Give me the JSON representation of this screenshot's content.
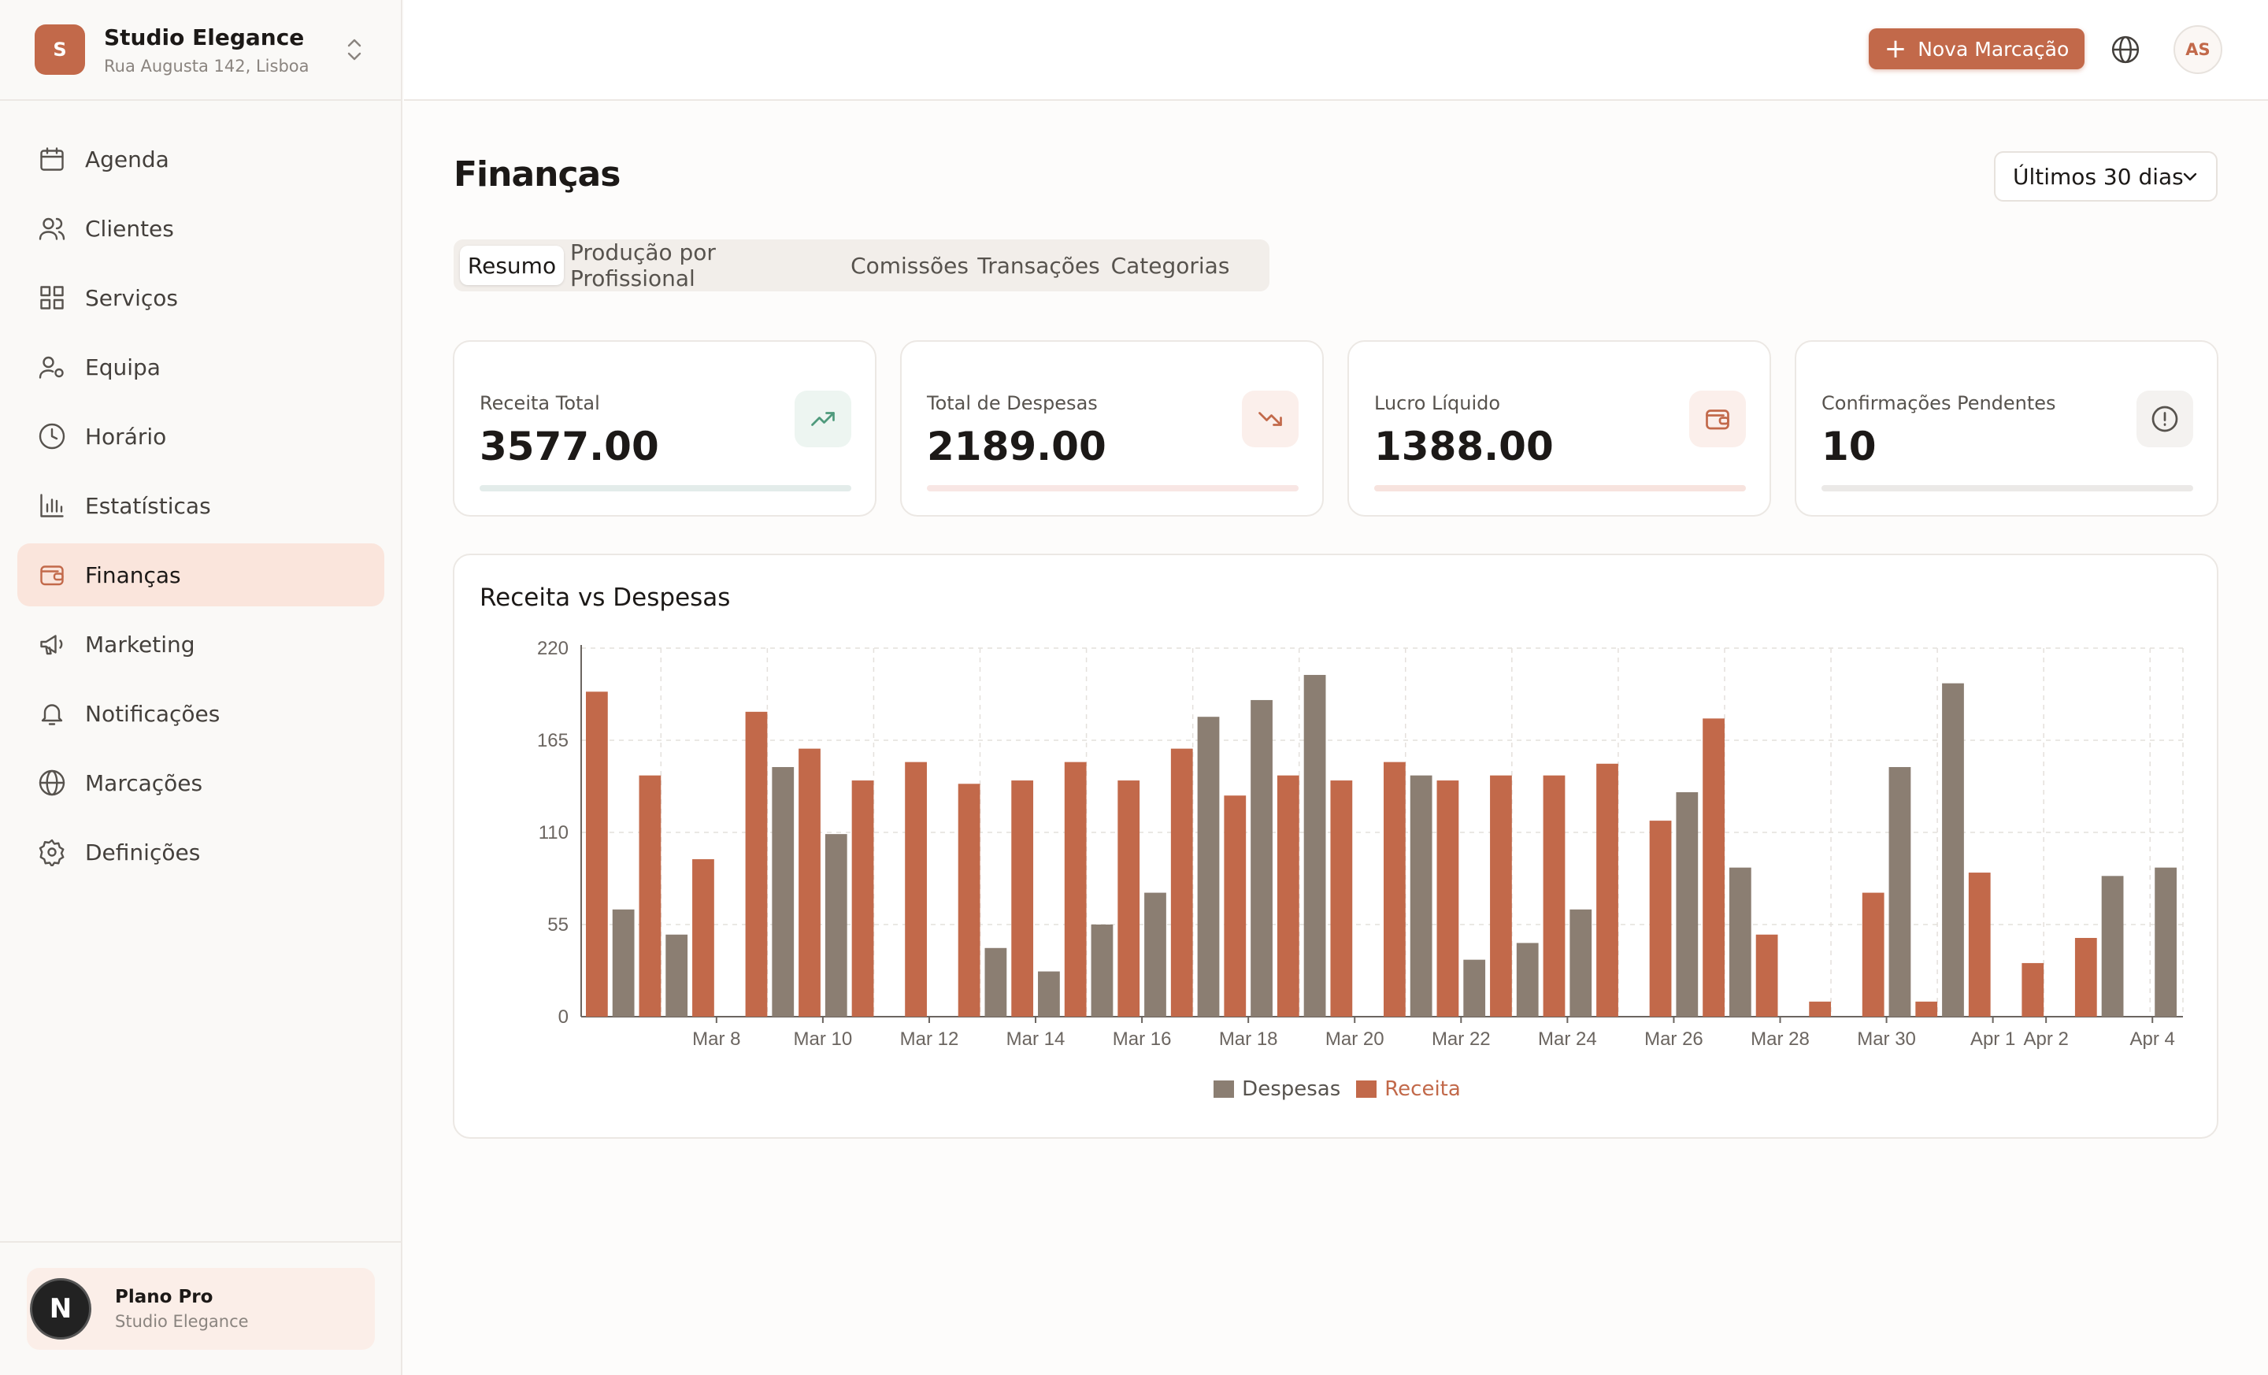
{
  "brand": {
    "initial": "S",
    "name": "Studio Elegance",
    "address": "Rua Augusta 142, Lisboa"
  },
  "nav": {
    "items": [
      {
        "label": "Agenda",
        "icon": "calendar-icon",
        "active": false
      },
      {
        "label": "Clientes",
        "icon": "users-icon",
        "active": false
      },
      {
        "label": "Serviços",
        "icon": "grid-icon",
        "active": false
      },
      {
        "label": "Equipa",
        "icon": "user-cog-icon",
        "active": false
      },
      {
        "label": "Horário",
        "icon": "clock-icon",
        "active": false
      },
      {
        "label": "Estatísticas",
        "icon": "bar-chart-icon",
        "active": false
      },
      {
        "label": "Finanças",
        "icon": "wallet-icon",
        "active": true
      },
      {
        "label": "Marketing",
        "icon": "megaphone-icon",
        "active": false
      },
      {
        "label": "Notificações",
        "icon": "bell-icon",
        "active": false
      },
      {
        "label": "Marcações",
        "icon": "globe-icon",
        "active": false
      },
      {
        "label": "Definições",
        "icon": "settings-icon",
        "active": false
      }
    ]
  },
  "plan": {
    "avatar": "N",
    "title": "Plano Pro",
    "subtitle": "Studio Elegance"
  },
  "topbar": {
    "new_booking": "Nova Marcação",
    "user_initials": "AS"
  },
  "page": {
    "title": "Finanças",
    "range": "Últimos 30 dias"
  },
  "tabs": [
    {
      "label": "Resumo",
      "active": true
    },
    {
      "label": "Produção por Profissional",
      "active": false
    },
    {
      "label": "Comissões",
      "active": false
    },
    {
      "label": "Transações",
      "active": false
    },
    {
      "label": "Categorias",
      "active": false
    }
  ],
  "cards": [
    {
      "label": "Receita Total",
      "value": "3577.00",
      "icon": "trending-up-icon",
      "icon_color": "#4f9a7c",
      "icon_bg": "#edf5f1",
      "bar_color": "#e3ecea"
    },
    {
      "label": "Total de Despesas",
      "value": "2189.00",
      "icon": "trending-down-icon",
      "icon_color": "#c2694a",
      "icon_bg": "#fbefeb",
      "bar_color": "#f8e6e4"
    },
    {
      "label": "Lucro Líquido",
      "value": "1388.00",
      "icon": "wallet-icon",
      "icon_color": "#c2694a",
      "icon_bg": "#fbefeb",
      "bar_color": "#f7e3de"
    },
    {
      "label": "Confirmações Pendentes",
      "value": "10",
      "icon": "alert-circle-icon",
      "icon_color": "#57534e",
      "icon_bg": "#f4f2f0",
      "bar_color": "#ebe9e7"
    }
  ],
  "chart": {
    "title": "Receita vs Despesas"
  },
  "chart_data": {
    "type": "bar",
    "ylim": [
      0,
      220
    ],
    "yticks": [
      0,
      55,
      110,
      165,
      220
    ],
    "categories": [
      "Mar 6",
      "Mar 7",
      "Mar 8",
      "Mar 9",
      "Mar 10",
      "Mar 11",
      "Mar 12",
      "Mar 13",
      "Mar 14",
      "Mar 15",
      "Mar 16",
      "Mar 17",
      "Mar 18",
      "Mar 19",
      "Mar 20",
      "Mar 21",
      "Mar 22",
      "Mar 23",
      "Mar 24",
      "Mar 25",
      "Mar 26",
      "Mar 27",
      "Mar 28",
      "Mar 29",
      "Mar 30",
      "Mar 31",
      "Apr 1",
      "Apr 2",
      "Apr 3",
      "Apr 4"
    ],
    "xtick_labels": [
      "Mar 8",
      "Mar 10",
      "Mar 12",
      "Mar 14",
      "Mar 16",
      "Mar 18",
      "Mar 20",
      "Mar 22",
      "Mar 24",
      "Mar 26",
      "Mar 28",
      "Mar 30",
      "Apr 1",
      "Apr 2",
      "Apr 4"
    ],
    "grid": true,
    "legend": "bottom-center",
    "series": [
      {
        "name": "Receita",
        "color": "#c2694a",
        "values": [
          194,
          144,
          94,
          182,
          160,
          141,
          152,
          139,
          141,
          152,
          141,
          160,
          132,
          144,
          141,
          152,
          141,
          144,
          144,
          151,
          117,
          178,
          49,
          9,
          74,
          9,
          86,
          32,
          47,
          0
        ]
      },
      {
        "name": "Despesas",
        "color": "#8b7e72",
        "values": [
          64,
          49,
          0,
          149,
          109,
          0,
          0,
          41,
          27,
          55,
          74,
          179,
          189,
          204,
          0,
          144,
          34,
          44,
          64,
          0,
          134,
          89,
          0,
          0,
          149,
          199,
          0,
          0,
          84,
          89
        ]
      }
    ]
  }
}
